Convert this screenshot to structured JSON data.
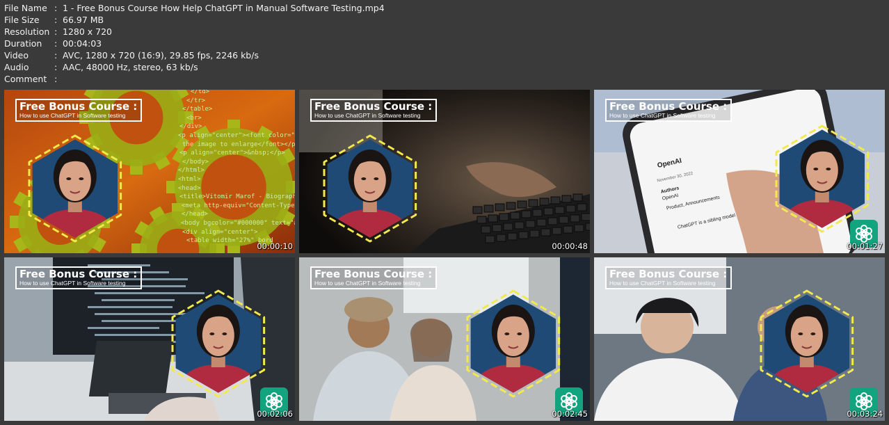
{
  "file_info": [
    {
      "key": "File Name",
      "value": "1 - Free Bonus Course How Help ChatGPT in Manual Software Testing.mp4"
    },
    {
      "key": "File Size",
      "value": "66.97 MB"
    },
    {
      "key": "Resolution",
      "value": "1280 x 720"
    },
    {
      "key": "Duration",
      "value": "00:04:03"
    },
    {
      "key": "Video",
      "value": "AVC, 1280 x 720 (16:9), 29.85 fps, 2246 kb/s"
    },
    {
      "key": "Audio",
      "value": "AAC, 48000 Hz, stereo, 63 kb/s"
    },
    {
      "key": "Comment",
      "value": ""
    }
  ],
  "overlay": {
    "title": "Free Bonus Course :",
    "subtitle": "How to use ChatGPT in Software testing"
  },
  "thumbnails": [
    {
      "timestamp": "00:00:10",
      "scene": "code-gears",
      "logo": false
    },
    {
      "timestamp": "00:00:48",
      "scene": "keyboard",
      "logo": false
    },
    {
      "timestamp": "00:01:27",
      "scene": "phone",
      "logo": true
    },
    {
      "timestamp": "00:02:06",
      "scene": "monitor",
      "logo": true
    },
    {
      "timestamp": "00:02:45",
      "scene": "office",
      "logo": true
    },
    {
      "timestamp": "00:03:24",
      "scene": "meeting",
      "logo": true
    }
  ],
  "code_text": [
    "</td>",
    "</tr>",
    "</table>",
    "<br>",
    "</div>",
    "<p align=\"center\"><font color=\"#FFFF",
    "the image to enlarge</font></p>",
    "<p align=\"center\">&nbsp;</p>",
    "</body>",
    "</html>",
    "<html>",
    "<head>",
    "<title>Vitomir Marof - Biography</titl",
    "<meta http-equiv=\"Content-Type\" con",
    "</head>",
    "<body bgcolor=\"#000000\" text=\"#FFFF",
    "<div align=\"center\">",
    "<table width=\"27%\" bord"
  ],
  "phone_text": {
    "brand": "OpenAI",
    "date": "November 30, 2022",
    "authors_label": "Authors",
    "author": "OpenAI",
    "category": "Product, Announcements",
    "body": "ChatGPT is a sibling model to InstructGPT"
  },
  "colors": {
    "hex_fill": "#1f4a75",
    "hex_dash": "#f2e94e",
    "shirt": "#b02a40",
    "gpt_green": "#12a37f",
    "page_bg": "#3a3a3a"
  }
}
